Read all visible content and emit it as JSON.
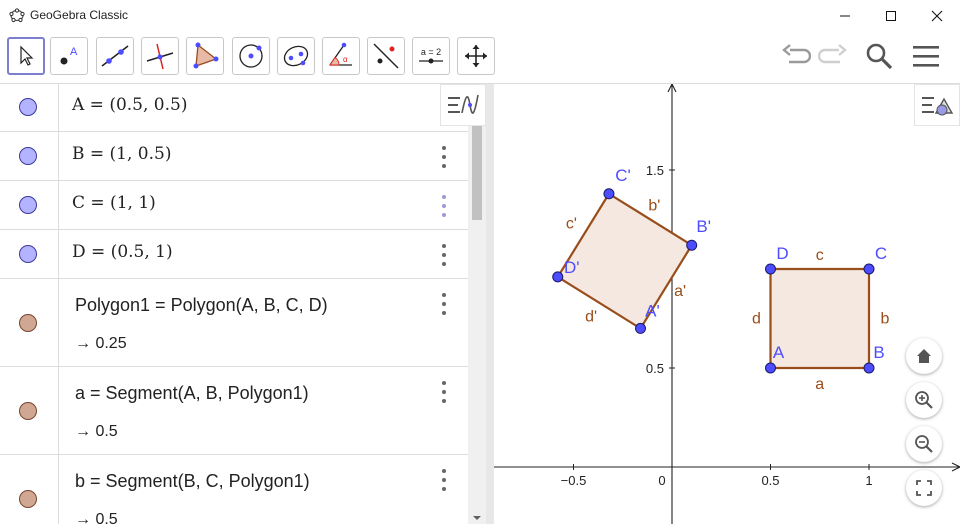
{
  "window": {
    "title": "GeoGebra Classic"
  },
  "toolbar": {
    "equal_tool_label": "a = 2"
  },
  "algebra": {
    "rows": [
      {
        "expr": "A = (0.5, 0.5)"
      },
      {
        "expr": "B = (1, 0.5)"
      },
      {
        "expr": "C = (1, 1)"
      },
      {
        "expr": "D = (0.5, 1)"
      },
      {
        "definition": "Polygon1 = Polygon(A, B, C, D)",
        "value": "→ 0.25"
      },
      {
        "definition": "a = Segment(A, B, Polygon1)",
        "value": "→ 0.5"
      },
      {
        "definition": "b = Segment(B, C, Polygon1)",
        "value": "→ 0.5"
      }
    ]
  },
  "graphics": {
    "x_ticks": [
      "−0.5",
      "0",
      "0.5",
      "1"
    ],
    "y_ticks": [
      "0.5",
      "1",
      "1.5"
    ],
    "points": [
      {
        "label": "A",
        "x": 0.5,
        "y": 0.5
      },
      {
        "label": "B",
        "x": 1,
        "y": 0.5
      },
      {
        "label": "C",
        "x": 1,
        "y": 1
      },
      {
        "label": "D",
        "x": 0.5,
        "y": 1
      },
      {
        "label": "A'",
        "x": -0.16,
        "y": 0.7
      },
      {
        "label": "B'",
        "x": 0.1,
        "y": 1.12
      },
      {
        "label": "C'",
        "x": -0.32,
        "y": 1.38
      },
      {
        "label": "D'",
        "x": -0.58,
        "y": 0.96
      }
    ],
    "segment_labels": [
      "a",
      "b",
      "c",
      "d",
      "a'",
      "b'",
      "c'",
      "d'"
    ],
    "colors": {
      "point": "#4d4dff",
      "segment": "#994d1a",
      "fill": "#f5e8e0"
    }
  }
}
